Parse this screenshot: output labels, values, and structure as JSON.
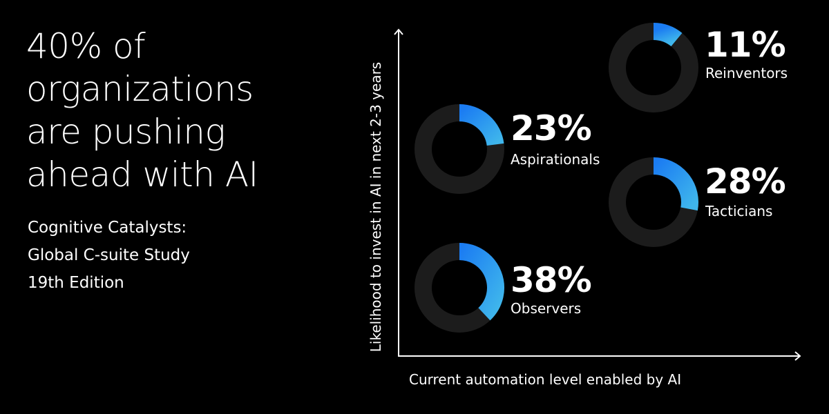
{
  "headline": {
    "lines": [
      "40% of",
      "organizations",
      "are pushing",
      "ahead with AI"
    ]
  },
  "source": {
    "lines": [
      "Cognitive Catalysts:",
      "Global C-suite Study",
      "19th Edition"
    ]
  },
  "colors": {
    "background": "#000000",
    "track": "#1c1c1c",
    "arc_start": "#1b7cf2",
    "arc_end": "#3fb6ec",
    "text": "#ffffff"
  },
  "chart_data": {
    "type": "quadrant-donut",
    "xlabel": "Current automation level enabled by AI",
    "ylabel": "Likelihood to invest in AI in next 2-3 years",
    "segments": [
      {
        "name": "Reinventors",
        "label": "11%",
        "value": 11,
        "quadrant": "top-right"
      },
      {
        "name": "Aspirationals",
        "label": "23%",
        "value": 23,
        "quadrant": "top-left"
      },
      {
        "name": "Tacticians",
        "label": "28%",
        "value": 28,
        "quadrant": "bottom-right"
      },
      {
        "name": "Observers",
        "label": "38%",
        "value": 38,
        "quadrant": "bottom-left"
      }
    ]
  }
}
